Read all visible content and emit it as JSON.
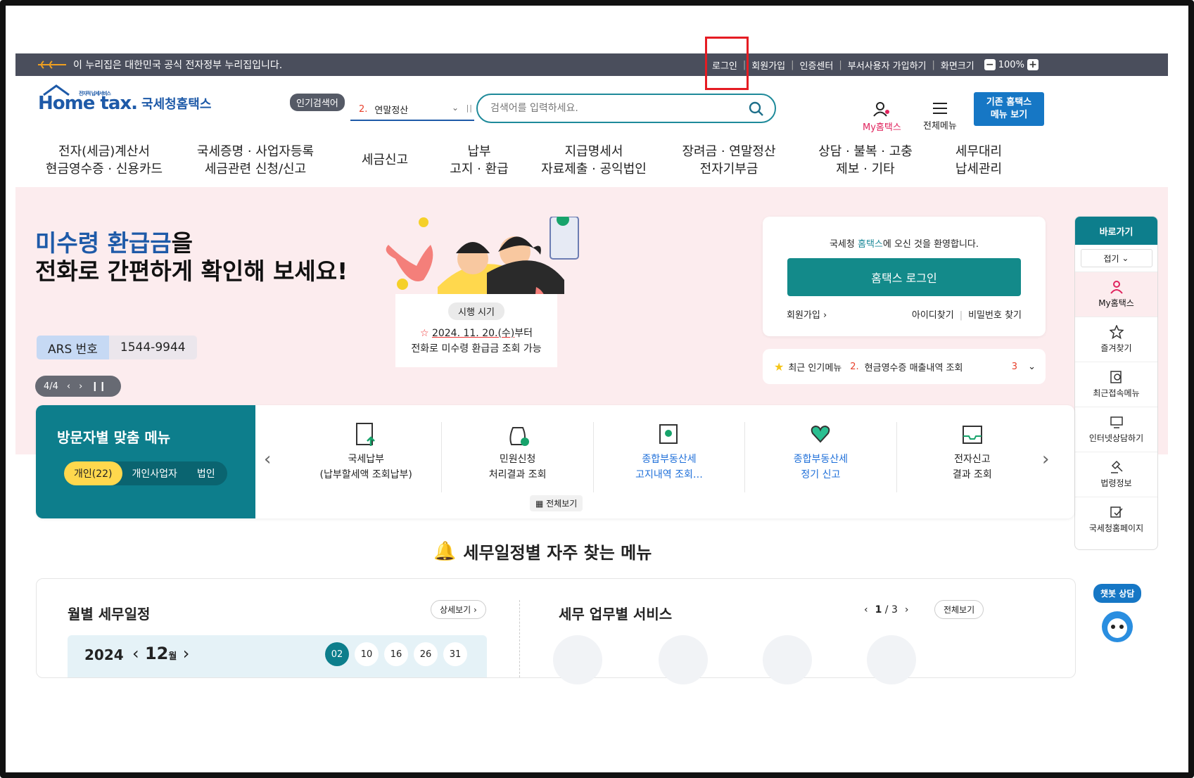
{
  "topbar": {
    "notice": "이 누리집은 대한민국 공식 전자정부 누리집입니다.",
    "links": [
      "로그인",
      "회원가입",
      "인증센터",
      "부서사용자 가입하기",
      "화면크기"
    ],
    "zoom_minus": "−",
    "zoom_value": "100%",
    "zoom_plus": "+"
  },
  "logo": {
    "brand": "Home tax.",
    "kr": "국세청홈택스",
    "tagline": "전자적 납세서비스"
  },
  "search": {
    "popular_label": "인기검색어",
    "popular_num": "2.",
    "popular_term": "연말정산",
    "placeholder": "검색어를 입력하세요."
  },
  "header": {
    "my": "My홈택스",
    "all": "전체메뉴",
    "old_line1": "기존 홈택스",
    "old_line2": "메뉴 보기"
  },
  "gnb": [
    {
      "l1": "전자(세금)계산서",
      "l2": "현금영수증 · 신용카드"
    },
    {
      "l1": "국세증명 · 사업자등록",
      "l2": "세금관련 신청/신고"
    },
    {
      "l1": "세금신고",
      "l2": ""
    },
    {
      "l1": "납부",
      "l2": "고지 · 환급"
    },
    {
      "l1": "지급명세서",
      "l2": "자료제출 · 공익법인"
    },
    {
      "l1": "장려금 · 연말정산",
      "l2": "전자기부금"
    },
    {
      "l1": "상담 · 불복 · 고충",
      "l2": "제보 · 기타"
    },
    {
      "l1": "세무대리",
      "l2": "납세관리"
    }
  ],
  "hero": {
    "line1a": "미수령 환급금",
    "line1b": "을",
    "line2": "전화로 간편하게 확인해 보세요!",
    "ars_label": "ARS 번호",
    "ars_number": "1544-9944",
    "pager": "4/4",
    "note_pill": "시행 시기",
    "note_date": "2024. 11. 20.(수)",
    "note_date_suffix": "부터",
    "note_line2": "전화로 미수령 환급금 조회 가능"
  },
  "login": {
    "welcome_pre": "국세청 ",
    "welcome_brand": "홈택스",
    "welcome_post": "에 오신 것을 환영합니다.",
    "button": "홈택스 로그인",
    "join": "회원가입",
    "find_id": "아이디찾기",
    "find_pw": "비밀번호 찾기"
  },
  "recent": {
    "label": "최근 인기메뉴",
    "num": "2.",
    "item": "현금영수증 매출내역 조회",
    "next_num": "3"
  },
  "quick": {
    "title": "바로가기",
    "fold": "접기",
    "items": [
      "My홈택스",
      "즐겨찾기",
      "최근접속메뉴",
      "인터넷상담하기",
      "법령정보",
      "국세청홈페이지"
    ]
  },
  "visitor": {
    "title": "방문자별 맞춤 메뉴",
    "tabs": [
      "개인(22)",
      "개인사업자",
      "법인"
    ],
    "items": [
      {
        "l1": "국세납부",
        "l2": "(납부할세액 조회납부)"
      },
      {
        "l1": "민원신청",
        "l2": "처리결과 조회"
      },
      {
        "l1": "종합부동산세",
        "l2": "고지내역 조회…"
      },
      {
        "l1": "종합부동산세",
        "l2": "정기 신고"
      },
      {
        "l1": "전자신고",
        "l2": "결과 조회"
      }
    ],
    "all_view": "전체보기"
  },
  "schedule": {
    "title": "세무일정별 자주 찾는 메뉴",
    "monthly": "월별 세무일정",
    "detail": "상세보기",
    "year": "2024",
    "month": "12",
    "month_unit": "월",
    "days": [
      "02",
      "10",
      "16",
      "26",
      "31"
    ],
    "service_title": "세무 업무별 서비스",
    "service_page": "1",
    "service_total": "3",
    "service_all": "전체보기"
  },
  "chatbot": {
    "label": "챗봇 상담"
  },
  "colors": {
    "teal": "#0d7e8c",
    "blue": "#1e5aa8",
    "topbar": "#4a4e5c",
    "hero_bg": "#fcecee",
    "accent_red": "#e8402c"
  }
}
